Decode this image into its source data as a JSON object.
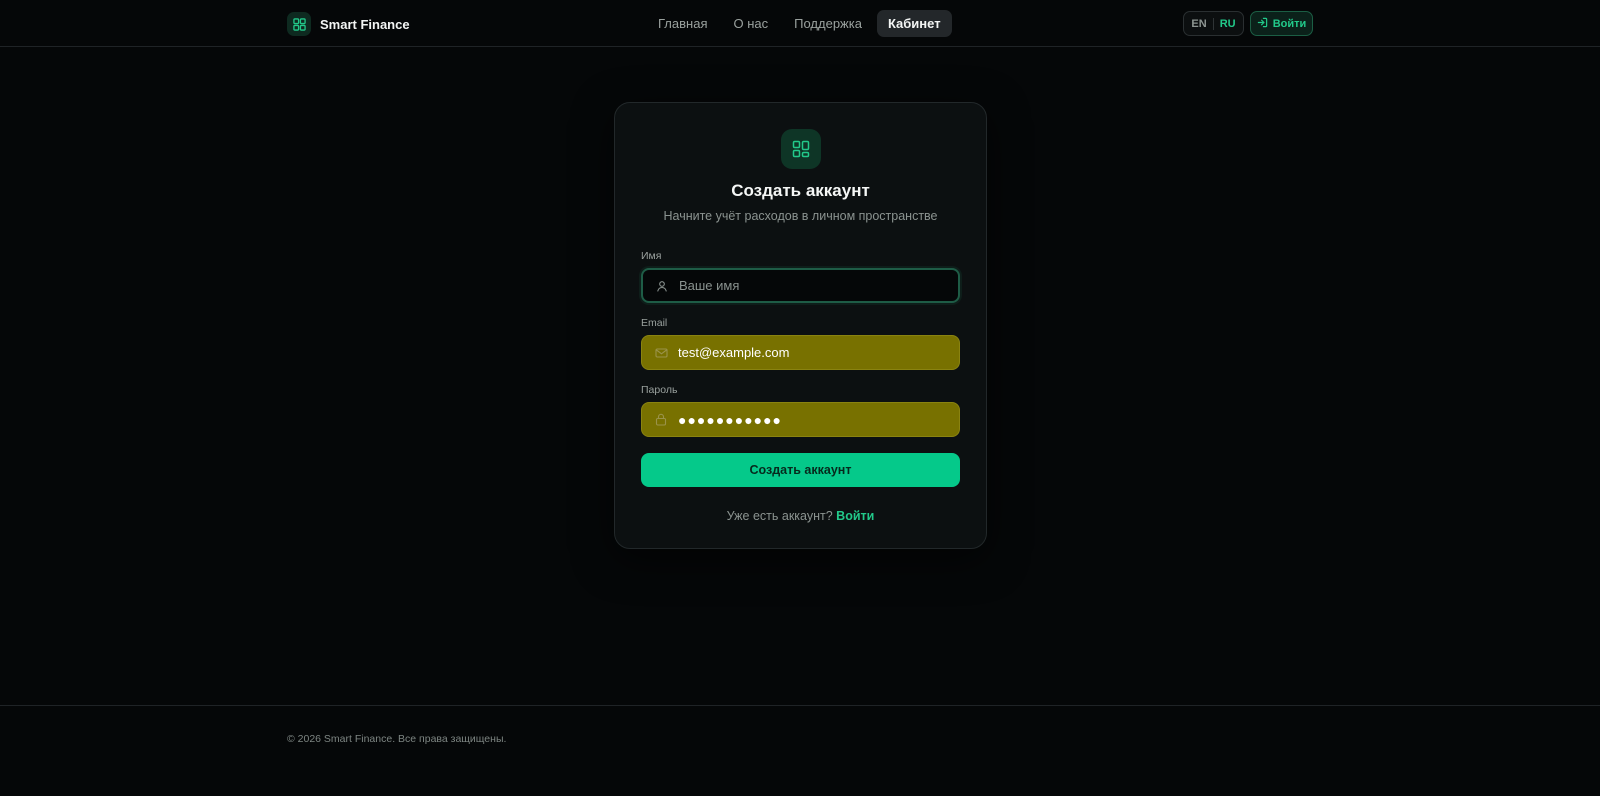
{
  "brand": {
    "name": "Smart Finance",
    "icon": "dashboard-grid-icon"
  },
  "nav": {
    "items": [
      {
        "label": "Главная"
      },
      {
        "label": "О нас"
      },
      {
        "label": "Поддержка"
      },
      {
        "label": "Кабинет",
        "active": true
      }
    ]
  },
  "lang": {
    "en": "EN",
    "ru": "RU",
    "selected": "RU"
  },
  "header": {
    "login_label": "Войти"
  },
  "card": {
    "title": "Создать аккаунт",
    "subtitle": "Начните учёт расходов в личном пространстве",
    "name_label": "Имя",
    "name_placeholder": "Ваше имя",
    "name_value": "",
    "email_label": "Email",
    "email_value": "test@example.com",
    "password_label": "Пароль",
    "password_value": "●●●●●●●●●●●",
    "submit_label": "Создать аккаунт",
    "have_account_text": "Уже есть аккаунт?",
    "login_link": "Войти"
  },
  "footer": {
    "copyright": "© 2026 Smart Finance. Все права защищены."
  },
  "colors": {
    "background": "#050708",
    "accent": "#05c98a",
    "autofill": "#787100",
    "card": "#0c1011"
  }
}
